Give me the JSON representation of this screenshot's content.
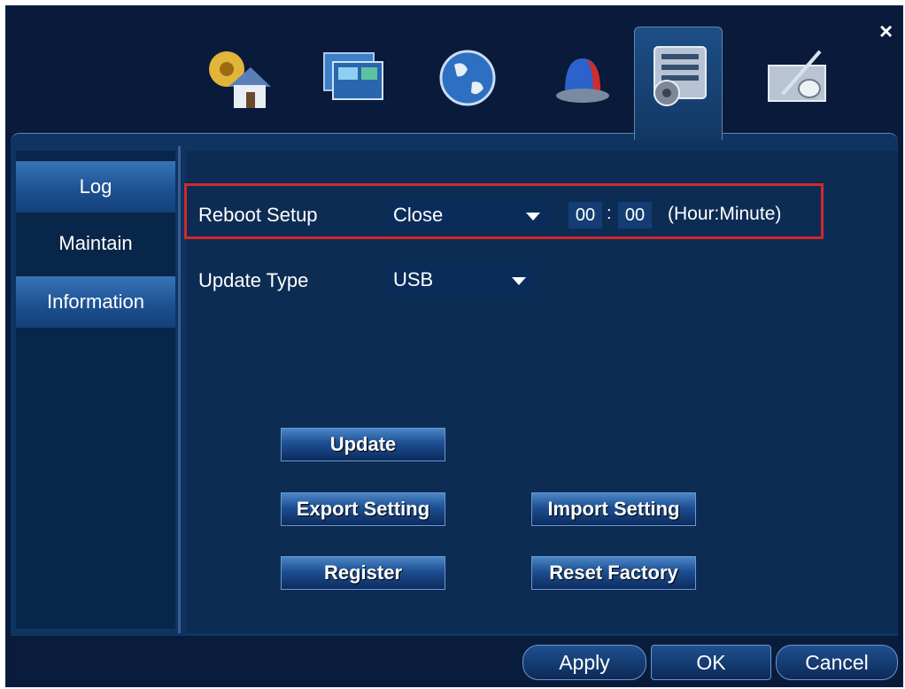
{
  "window": {
    "close_glyph": "×"
  },
  "top_tabs": [
    {
      "icon": "general-settings-icon",
      "active": false
    },
    {
      "icon": "display-icon",
      "active": false
    },
    {
      "icon": "network-globe-icon",
      "active": false
    },
    {
      "icon": "alarm-siren-icon",
      "active": false
    },
    {
      "icon": "system-settings-icon",
      "active": true
    },
    {
      "icon": "advanced-tools-icon",
      "active": false
    }
  ],
  "sidebar": {
    "items": [
      {
        "label": "Log"
      },
      {
        "label": "Maintain"
      },
      {
        "label": "Information"
      }
    ]
  },
  "reboot": {
    "label": "Reboot Setup",
    "value": "Close",
    "hour": "00",
    "separator": ":",
    "minute": "00",
    "hint": "(Hour:Minute)"
  },
  "update_type": {
    "label": "Update Type",
    "value": "USB"
  },
  "actions": {
    "update": "Update",
    "export": "Export Setting",
    "import": "Import Setting",
    "register": "Register",
    "reset": "Reset Factory"
  },
  "footer": {
    "apply": "Apply",
    "ok": "OK",
    "cancel": "Cancel"
  },
  "colors": {
    "highlight": "#d02a2a",
    "background": "#0a1a3a",
    "panel": "#0f3462"
  }
}
